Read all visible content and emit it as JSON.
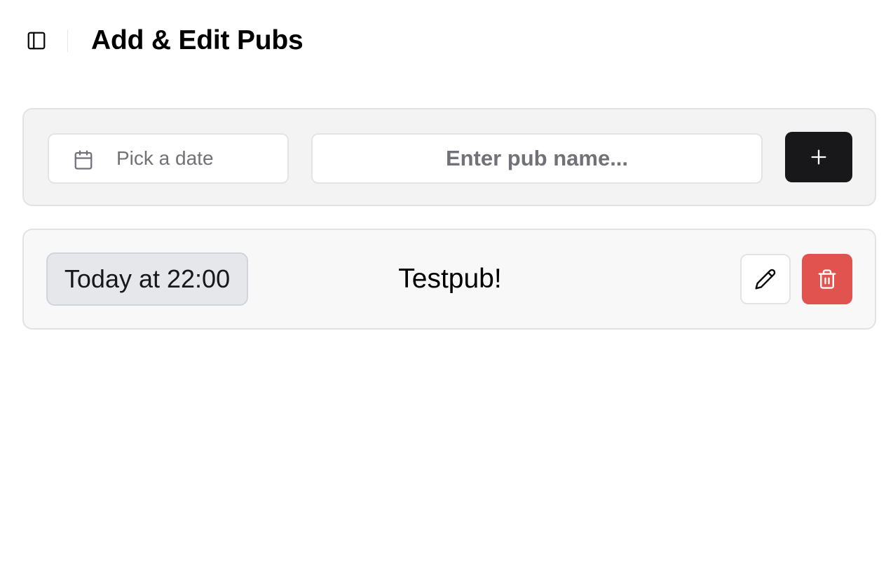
{
  "header": {
    "title": "Add & Edit Pubs",
    "toggle_icon": "sidebar-toggle-icon"
  },
  "add_form": {
    "date_placeholder": "Pick a date",
    "date_icon": "calendar-icon",
    "name_placeholder": "Enter pub name...",
    "name_value": "",
    "add_icon": "plus-icon"
  },
  "pubs": [
    {
      "date_label": "Today at 22:00",
      "name": "Testpub!",
      "edit_icon": "pencil-icon",
      "delete_icon": "trash-icon"
    }
  ],
  "colors": {
    "primary_button": "#18181b",
    "danger": "#e0534e",
    "muted_text": "#71717a"
  }
}
